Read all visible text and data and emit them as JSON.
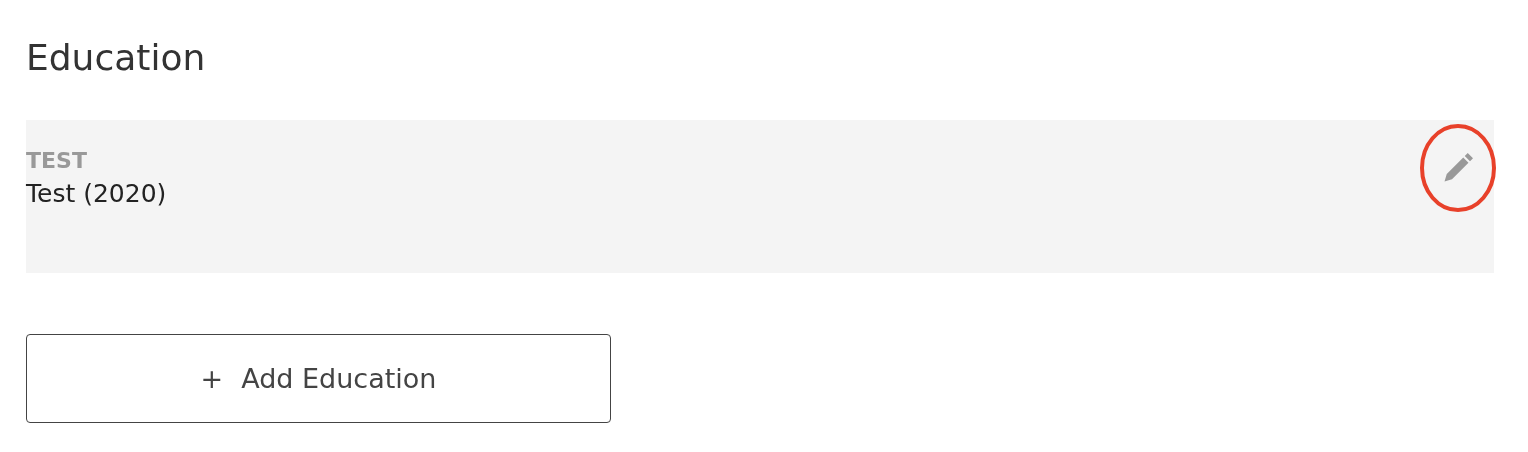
{
  "section": {
    "title": "Education"
  },
  "entries": [
    {
      "institution": "TEST",
      "detail": "Test (2020)",
      "highlighted": true
    }
  ],
  "add_button": {
    "icon": "+",
    "label": "Add Education"
  }
}
